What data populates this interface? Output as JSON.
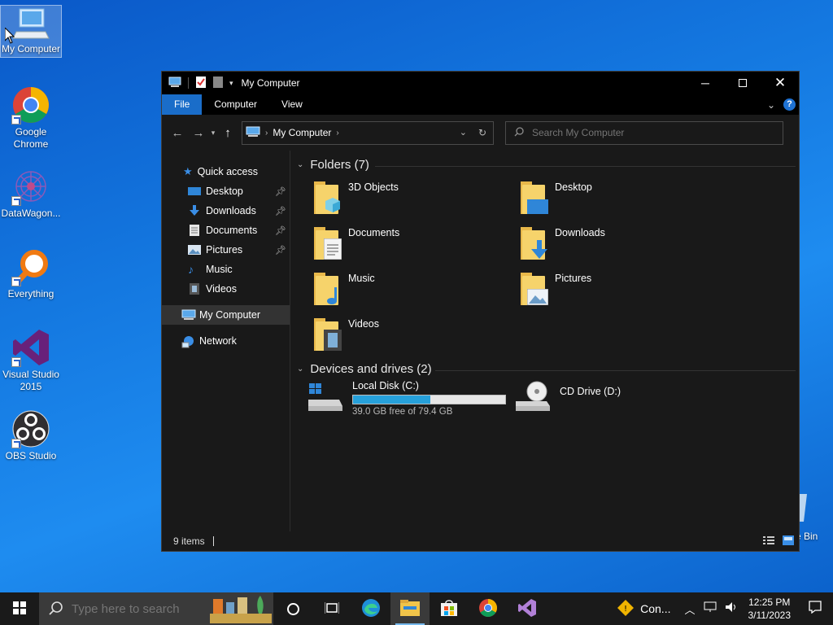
{
  "desktop": {
    "icons": [
      {
        "label": "My Computer"
      },
      {
        "label": "Google Chrome"
      },
      {
        "label": "DataWagon..."
      },
      {
        "label": "Everything"
      },
      {
        "label": "Visual Studio 2015"
      },
      {
        "label": "OBS Studio"
      },
      {
        "label": "e Bin"
      }
    ]
  },
  "window": {
    "title": "My Computer",
    "ribbon_tabs": [
      "File",
      "Computer",
      "View"
    ],
    "help_label": "?",
    "address_path": "My Computer",
    "search_placeholder": "Search My Computer",
    "nav": {
      "quick_access": "Quick access",
      "items": [
        "Desktop",
        "Downloads",
        "Documents",
        "Pictures",
        "Music",
        "Videos"
      ],
      "my_computer": "My Computer",
      "network": "Network"
    },
    "folders_header": "Folders (7)",
    "folders": [
      "3D Objects",
      "Desktop",
      "Documents",
      "Downloads",
      "Music",
      "Pictures",
      "Videos"
    ],
    "drives_header": "Devices and drives (2)",
    "drives": [
      {
        "name": "Local Disk (C:)",
        "free": "39.0 GB free of 79.4 GB",
        "used_fraction": 0.509
      },
      {
        "name": "CD Drive (D:)"
      }
    ],
    "status_items": "9 items"
  },
  "taskbar": {
    "search_placeholder": "Type here to search",
    "tray_app_label": "Con...",
    "time": "12:25 PM",
    "date": "3/11/2023"
  },
  "colors": {
    "accent": "#1a6dc9",
    "drive_bar": "#26a0da",
    "window_bg": "#191919",
    "desktop_bg": "#1478e0"
  }
}
